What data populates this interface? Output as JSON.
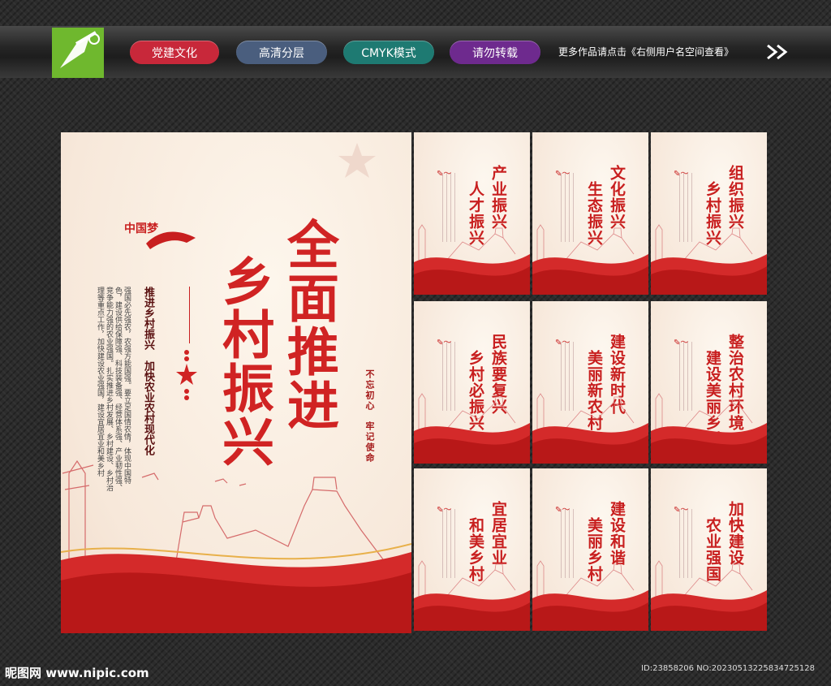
{
  "header": {
    "tags": [
      {
        "label": "党建文化",
        "color": "#c8283a"
      },
      {
        "label": "高清分层",
        "color": "#4a5e7e"
      },
      {
        "label": "CMYK模式",
        "color": "#1e7a72"
      },
      {
        "label": "请勿转载",
        "color": "#6e2a8e"
      }
    ],
    "note": "更多作品请点击《右侧用户名空间查看》"
  },
  "main_poster": {
    "title_line1": "全面推进",
    "title_line2": "乡村振兴",
    "subtitle": "推进乡村振兴　加快农业农村现代化",
    "body": "强国必先强农，农强方能国强。要立足国情农情，体现中国特色，建设供给保障强、科技装备强、经营体系强、产业韧性强、竞争能力强的农业强国。扎实推进乡村发展、乡村建设、乡村治理等重点工作，加快建设农业强国，建设宜居宜业和美乡村",
    "slogan_1": "不忘初心",
    "slogan_2": "牢记使命",
    "logo_text": "中国梦"
  },
  "small_posters": [
    {
      "line1": "产业振兴",
      "line2": "人才振兴"
    },
    {
      "line1": "文化振兴",
      "line2": "生态振兴"
    },
    {
      "line1": "组织振兴",
      "line2": "乡村振兴"
    },
    {
      "line1": "民族要复兴",
      "line2": "乡村必振兴"
    },
    {
      "line1": "建设新时代",
      "line2": "美丽新农村"
    },
    {
      "line1": "整治农村环境",
      "line2": "建设美丽乡村"
    },
    {
      "line1": "宜居宜业",
      "line2": "和美乡村"
    },
    {
      "line1": "建设和谐",
      "line2": "美丽乡村"
    },
    {
      "line1": "加快建设",
      "line2": "农业强国"
    }
  ],
  "footer": {
    "site": "昵图网 www.nipic.com",
    "id": "ID:23858206 NO:20230513225834725128"
  },
  "colors": {
    "accent_red": "#d02323",
    "logo_green": "#6fb82e"
  }
}
